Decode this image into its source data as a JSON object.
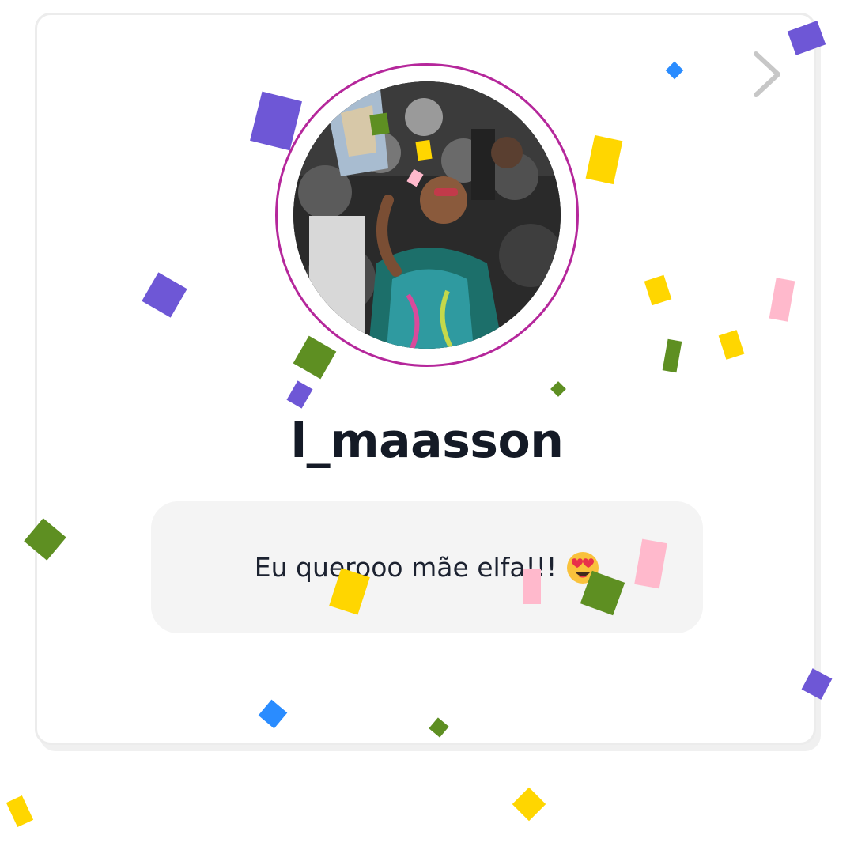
{
  "profile": {
    "username": "l_maasson",
    "avatar_alt": "profile photo"
  },
  "comment": {
    "text": "Eu querooo mãe elfa!!!",
    "emoji": "smiling-face-with-heart-eyes"
  },
  "navigation": {
    "next_icon": "chevron-right-icon"
  },
  "colors": {
    "ring": "#b5279b",
    "username": "#141a26",
    "comment_bg": "#f4f4f4",
    "confetti": [
      "#6e57d6",
      "#ffd600",
      "#5e8f22",
      "#ffb9cc",
      "#2a8cff"
    ]
  }
}
